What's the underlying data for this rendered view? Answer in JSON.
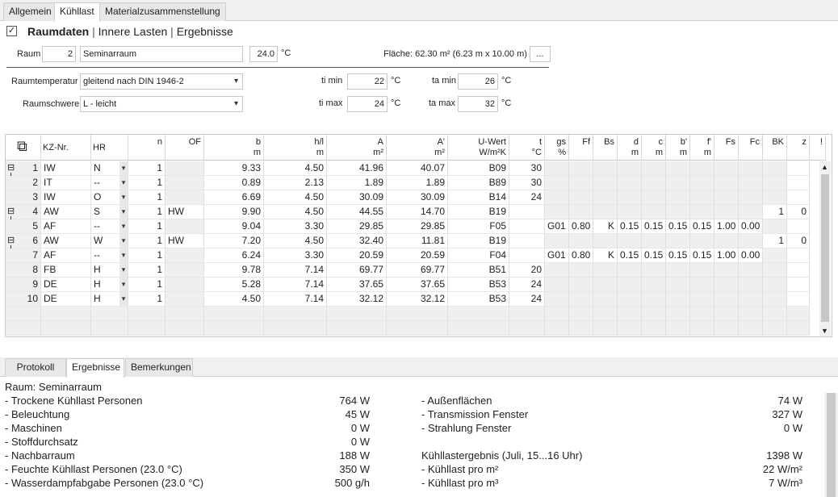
{
  "tabs": [
    "Allgemein",
    "Kühllast",
    "Materialzusammenstellung"
  ],
  "section": {
    "title": "Raumdaten",
    "link1": "Innere Lasten",
    "link2": "Ergebnisse",
    "sep": "|"
  },
  "room": {
    "raum_label": "Raum",
    "number": "2",
    "name": "Seminarraum",
    "temp": "24.0",
    "temp_unit": "°C",
    "area_text": "Fläche: 62.30  m² (6.23 m x 10.00 m)",
    "more_button": "..."
  },
  "params": {
    "raumtemp_label": "Raumtemperatur",
    "raumtemp_value": "gleitend nach DIN 1946-2",
    "raumschwere_label": "Raumschwere",
    "raumschwere_value": "L - leicht",
    "timin_label": "ti min",
    "timin": "22",
    "timax_label": "ti max",
    "timax": "24",
    "tamin_label": "ta min",
    "tamin": "26",
    "tamax_label": "ta max",
    "tamax": "32",
    "unit": "°C"
  },
  "grid": {
    "headers": [
      [
        "",
        ""
      ],
      [
        "KZ-Nr.",
        ""
      ],
      [
        "HR",
        ""
      ],
      [
        "n",
        ""
      ],
      [
        "OF",
        ""
      ],
      [
        "b",
        "m"
      ],
      [
        "h/l",
        "m"
      ],
      [
        "A",
        "m²"
      ],
      [
        "A'",
        "m²"
      ],
      [
        "U-Wert",
        "W/m²K"
      ],
      [
        "t",
        "°C"
      ],
      [
        "gs",
        "%"
      ],
      [
        "Ff",
        ""
      ],
      [
        "Bs",
        ""
      ],
      [
        "d",
        "m"
      ],
      [
        "c",
        "m"
      ],
      [
        "b'",
        "m"
      ],
      [
        "f'",
        "m"
      ],
      [
        "Fs",
        ""
      ],
      [
        "Fc",
        ""
      ],
      [
        "BK",
        ""
      ],
      [
        "z",
        ""
      ],
      [
        "!",
        ""
      ]
    ],
    "rows": [
      [
        "1",
        "IW",
        "N",
        "1",
        "",
        "9.33",
        "4.50",
        "41.96",
        "40.07",
        "B09",
        "30",
        "",
        "",
        "",
        "",
        "",
        "",
        "",
        "",
        "",
        "",
        ""
      ],
      [
        "2",
        "IT",
        "--",
        "1",
        "",
        "0.89",
        "2.13",
        "1.89",
        "1.89",
        "B89",
        "30",
        "",
        "",
        "",
        "",
        "",
        "",
        "",
        "",
        "",
        "",
        ""
      ],
      [
        "3",
        "IW",
        "O",
        "1",
        "",
        "6.69",
        "4.50",
        "30.09",
        "30.09",
        "B14",
        "24",
        "",
        "",
        "",
        "",
        "",
        "",
        "",
        "",
        "",
        "",
        ""
      ],
      [
        "4",
        "AW",
        "S",
        "1",
        "HW",
        "9.90",
        "4.50",
        "44.55",
        "14.70",
        "B19",
        "",
        "",
        "",
        "",
        "",
        "",
        "",
        "",
        "",
        "",
        "1",
        "0"
      ],
      [
        "5",
        "AF",
        "--",
        "1",
        "",
        "9.04",
        "3.30",
        "29.85",
        "29.85",
        "F05",
        "",
        "G01",
        "0.80",
        "K",
        "0.15",
        "0.15",
        "0.15",
        "0.15",
        "1.00",
        "0.00",
        "",
        ""
      ],
      [
        "6",
        "AW",
        "W",
        "1",
        "HW",
        "7.20",
        "4.50",
        "32.40",
        "11.81",
        "B19",
        "",
        "",
        "",
        "",
        "",
        "",
        "",
        "",
        "",
        "",
        "1",
        "0"
      ],
      [
        "7",
        "AF",
        "--",
        "1",
        "",
        "6.24",
        "3.30",
        "20.59",
        "20.59",
        "F04",
        "",
        "G01",
        "0.80",
        "K",
        "0.15",
        "0.15",
        "0.15",
        "0.15",
        "1.00",
        "0.00",
        "",
        ""
      ],
      [
        "8",
        "FB",
        "H",
        "1",
        "",
        "9.78",
        "7.14",
        "69.77",
        "69.77",
        "B51",
        "20",
        "",
        "",
        "",
        "",
        "",
        "",
        "",
        "",
        "",
        "",
        ""
      ],
      [
        "9",
        "DE",
        "H",
        "1",
        "",
        "5.28",
        "7.14",
        "37.65",
        "37.65",
        "B53",
        "24",
        "",
        "",
        "",
        "",
        "",
        "",
        "",
        "",
        "",
        "",
        ""
      ],
      [
        "10",
        "DE",
        "H",
        "1",
        "",
        "4.50",
        "7.14",
        "32.12",
        "32.12",
        "B53",
        "24",
        "",
        "",
        "",
        "",
        "",
        "",
        "",
        "",
        "",
        "",
        ""
      ]
    ]
  },
  "bottom_tabs": [
    "Protokoll",
    "Ergebnisse",
    "Bemerkungen"
  ],
  "results": {
    "room_line": "Raum: Seminarraum",
    "left": [
      [
        "- Trockene Kühllast Personen",
        "764 W"
      ],
      [
        "- Beleuchtung",
        "45 W"
      ],
      [
        "- Maschinen",
        "0 W"
      ],
      [
        "- Stoffdurchsatz",
        "0 W"
      ],
      [
        "- Nachbarraum",
        "188 W"
      ],
      [
        "- Feuchte Kühllast Personen (23.0 °C)",
        "350 W"
      ],
      [
        "- Wasserdampfabgabe Personen (23.0 °C)",
        "500 g/h"
      ]
    ],
    "right": [
      [
        "- Außenflächen",
        "74 W"
      ],
      [
        "- Transmission Fenster",
        "327 W"
      ],
      [
        "- Strahlung Fenster",
        "0 W"
      ],
      [
        "",
        ""
      ],
      [
        "Kühllastergebnis (Juli, 15...16 Uhr)",
        "1398 W"
      ],
      [
        "- Kühllast pro m²",
        "22 W/m²"
      ],
      [
        "- Kühllast pro m³",
        "7 W/m³"
      ]
    ]
  }
}
